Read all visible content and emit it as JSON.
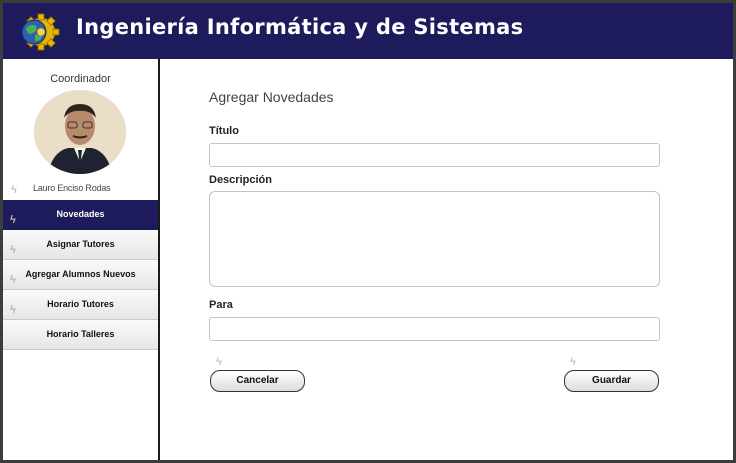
{
  "header": {
    "title": "Ingeniería Informática y de Sistemas"
  },
  "sidebar": {
    "role": "Coordinador",
    "user_name": "Lauro Enciso Rodas",
    "items": [
      {
        "label": "Novedades",
        "active": true
      },
      {
        "label": "Asignar Tutores",
        "active": false
      },
      {
        "label": "Agregar Alumnos Nuevos",
        "active": false
      },
      {
        "label": "Horario Tutores",
        "active": false
      },
      {
        "label": "Horario Talleres",
        "active": false
      }
    ]
  },
  "form": {
    "title": "Agregar Novedades",
    "titulo_label": "Título",
    "titulo_value": "",
    "descripcion_label": "Descripción",
    "descripcion_value": "",
    "para_label": "Para",
    "para_value": "",
    "cancel_label": "Cancelar",
    "save_label": "Guardar"
  },
  "colors": {
    "brand": "#1d1b5c",
    "logo_gear": "#e8b500",
    "logo_globe": "#2f5fb0"
  }
}
